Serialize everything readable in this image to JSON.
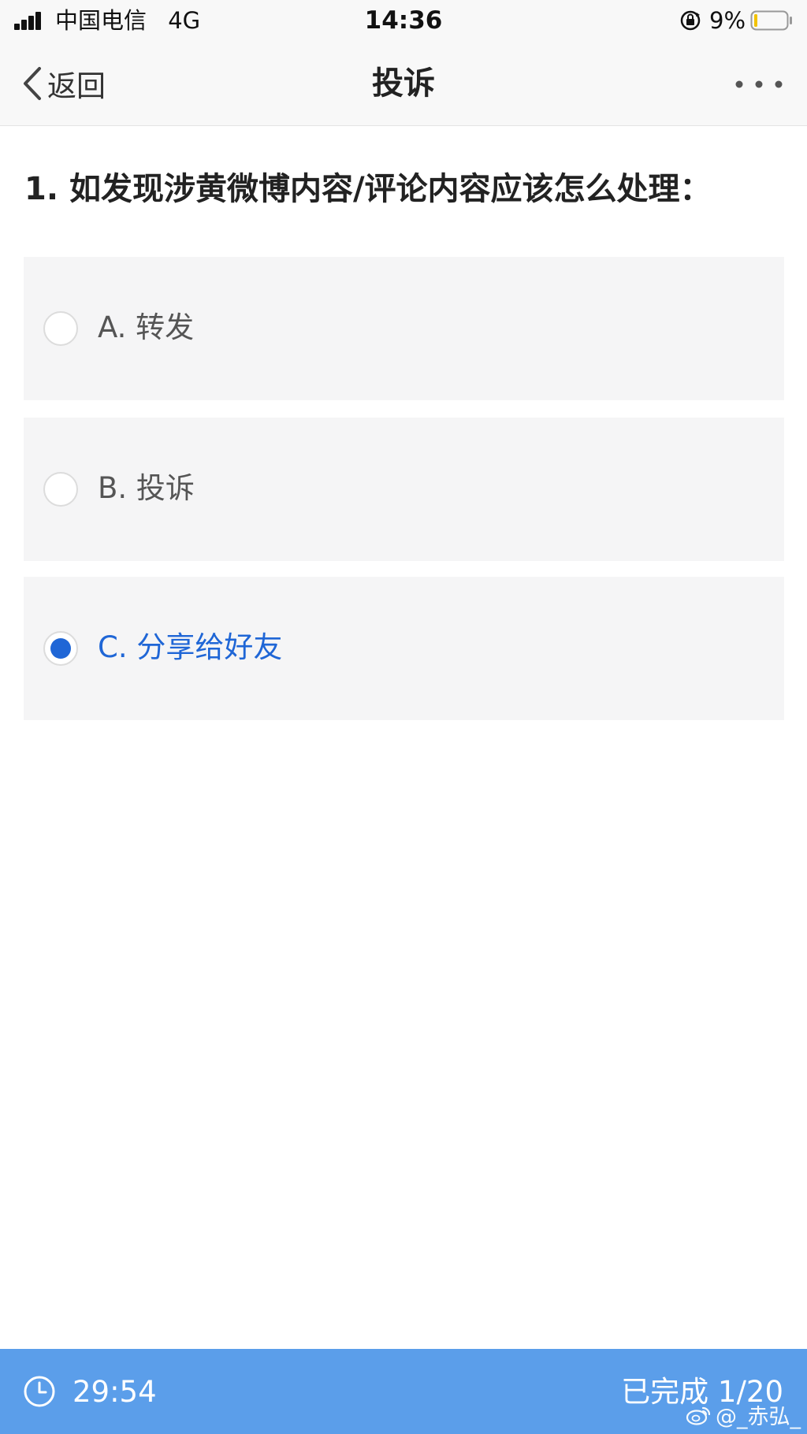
{
  "status_bar": {
    "carrier": "中国电信",
    "network": "4G",
    "time": "14:36",
    "battery_percent": "9%",
    "battery_level": 0.09
  },
  "nav": {
    "back_label": "返回",
    "title": "投诉"
  },
  "question": {
    "text": "1. 如发现涉黄微博内容/评论内容应该怎么处理："
  },
  "options": [
    {
      "label": "A. 转发",
      "selected": false
    },
    {
      "label": "B. 投诉",
      "selected": false
    },
    {
      "label": "C. 分享给好友",
      "selected": true
    }
  ],
  "footer": {
    "timer": "29:54",
    "progress": "已完成 1/20",
    "watermark": "@_赤弘_"
  },
  "colors": {
    "accent": "#1f66d6",
    "footer_bg": "#5b9eea",
    "option_bg": "#f5f5f6"
  },
  "icons": {
    "back": "chevron-left-icon",
    "more": "more-dots-icon",
    "timer": "clock-icon",
    "orientation_lock": "orientation-lock-icon",
    "battery": "battery-icon",
    "signal": "signal-icon",
    "watermark": "weibo-logo-icon"
  }
}
